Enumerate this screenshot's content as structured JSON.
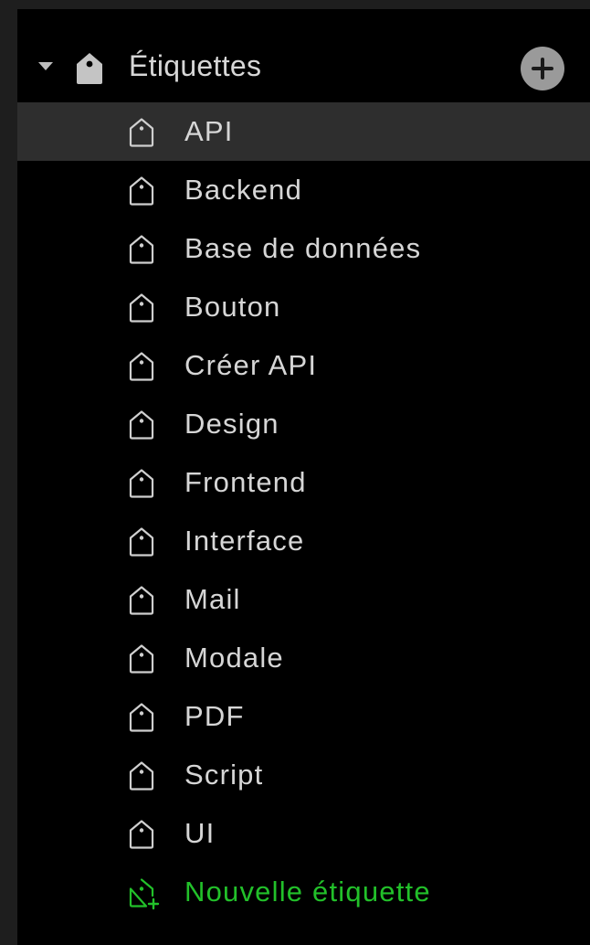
{
  "sidebar": {
    "section": {
      "title": "Étiquettes",
      "expanded": true,
      "disclosure_icon": "triangle-down-icon",
      "section_icon": "tag-filled-icon",
      "add_icon": "plus-circle-icon"
    },
    "tags": [
      {
        "label": "API",
        "selected": true
      },
      {
        "label": "Backend"
      },
      {
        "label": "Base de données"
      },
      {
        "label": "Bouton"
      },
      {
        "label": "Créer API"
      },
      {
        "label": "Design"
      },
      {
        "label": "Frontend"
      },
      {
        "label": "Interface"
      },
      {
        "label": "Mail"
      },
      {
        "label": "Modale"
      },
      {
        "label": "PDF"
      },
      {
        "label": "Script"
      },
      {
        "label": "UI"
      }
    ],
    "new_tag": {
      "label": "Nouvelle étiquette",
      "icon": "tag-plus-icon"
    }
  },
  "colors": {
    "background": "#000000",
    "selected_row": "#2e2e2e",
    "text": "#d6d6d6",
    "accent_green": "#22c02a",
    "add_button": "#9a9a9a"
  }
}
